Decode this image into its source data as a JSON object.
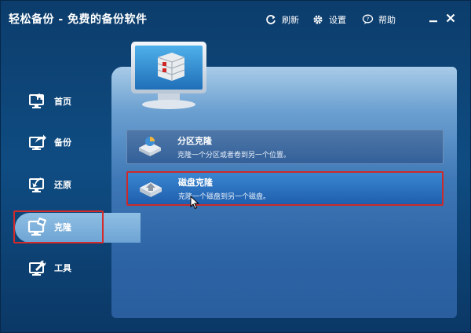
{
  "window": {
    "title": "轻松备份 - 免费的备份软件"
  },
  "toolbar": {
    "refresh_label": "刷新",
    "settings_label": "设置",
    "help_label": "帮助"
  },
  "sidebar": {
    "items": [
      {
        "label": "首页",
        "icon": "home-monitor-icon",
        "selected": false
      },
      {
        "label": "备份",
        "icon": "backup-monitor-icon",
        "selected": false
      },
      {
        "label": "还原",
        "icon": "restore-monitor-icon",
        "selected": false
      },
      {
        "label": "克隆",
        "icon": "clone-monitor-icon",
        "selected": true
      },
      {
        "label": "工具",
        "icon": "tools-monitor-icon",
        "selected": false
      }
    ]
  },
  "main": {
    "options": [
      {
        "title": "分区克隆",
        "description": "克隆一个分区或者卷到另一个位置。",
        "icon": "partition-clone-icon"
      },
      {
        "title": "磁盘克隆",
        "description": "克隆一个磁盘到另一个磁盘。",
        "icon": "disk-clone-icon",
        "highlighted": true
      }
    ]
  },
  "colors": {
    "highlight_border": "#cc2a2a",
    "window_bg": "#0f4c82",
    "selected_nav": "#8fbfe3"
  }
}
